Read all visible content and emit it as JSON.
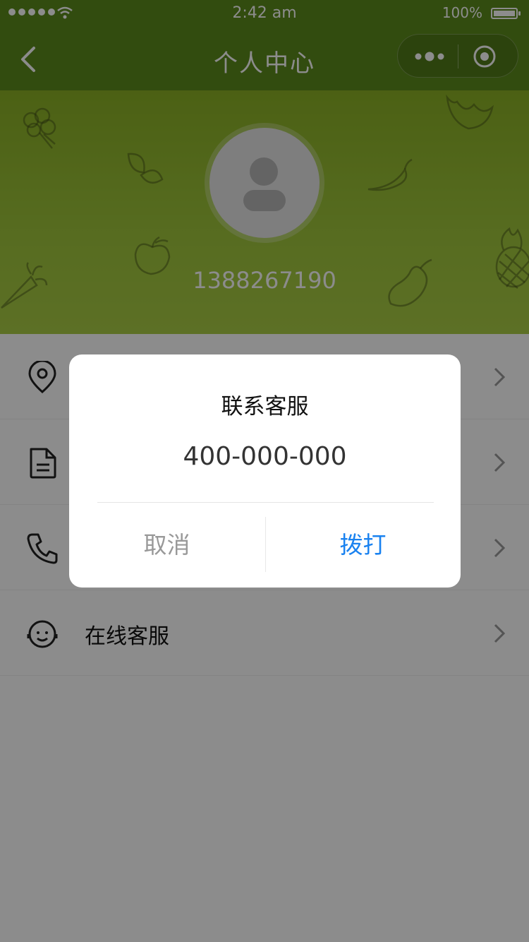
{
  "status_bar": {
    "time": "2:42 am",
    "battery": "100%"
  },
  "nav": {
    "title": "个人中心"
  },
  "profile": {
    "phone": "1388267190"
  },
  "menu": {
    "items": [
      {
        "label": "",
        "icon": "location-pin-icon"
      },
      {
        "label": "",
        "icon": "document-icon"
      },
      {
        "label": "",
        "icon": "phone-icon"
      },
      {
        "label": "在线客服",
        "icon": "customer-service-icon"
      }
    ]
  },
  "modal": {
    "title": "联系客服",
    "content": "400-000-000",
    "cancel": "取消",
    "confirm": "拨打"
  },
  "colors": {
    "nav": "#5b8a1c",
    "banner": "#9dc43a",
    "confirm": "#1a82f0",
    "cancel": "#999999"
  }
}
